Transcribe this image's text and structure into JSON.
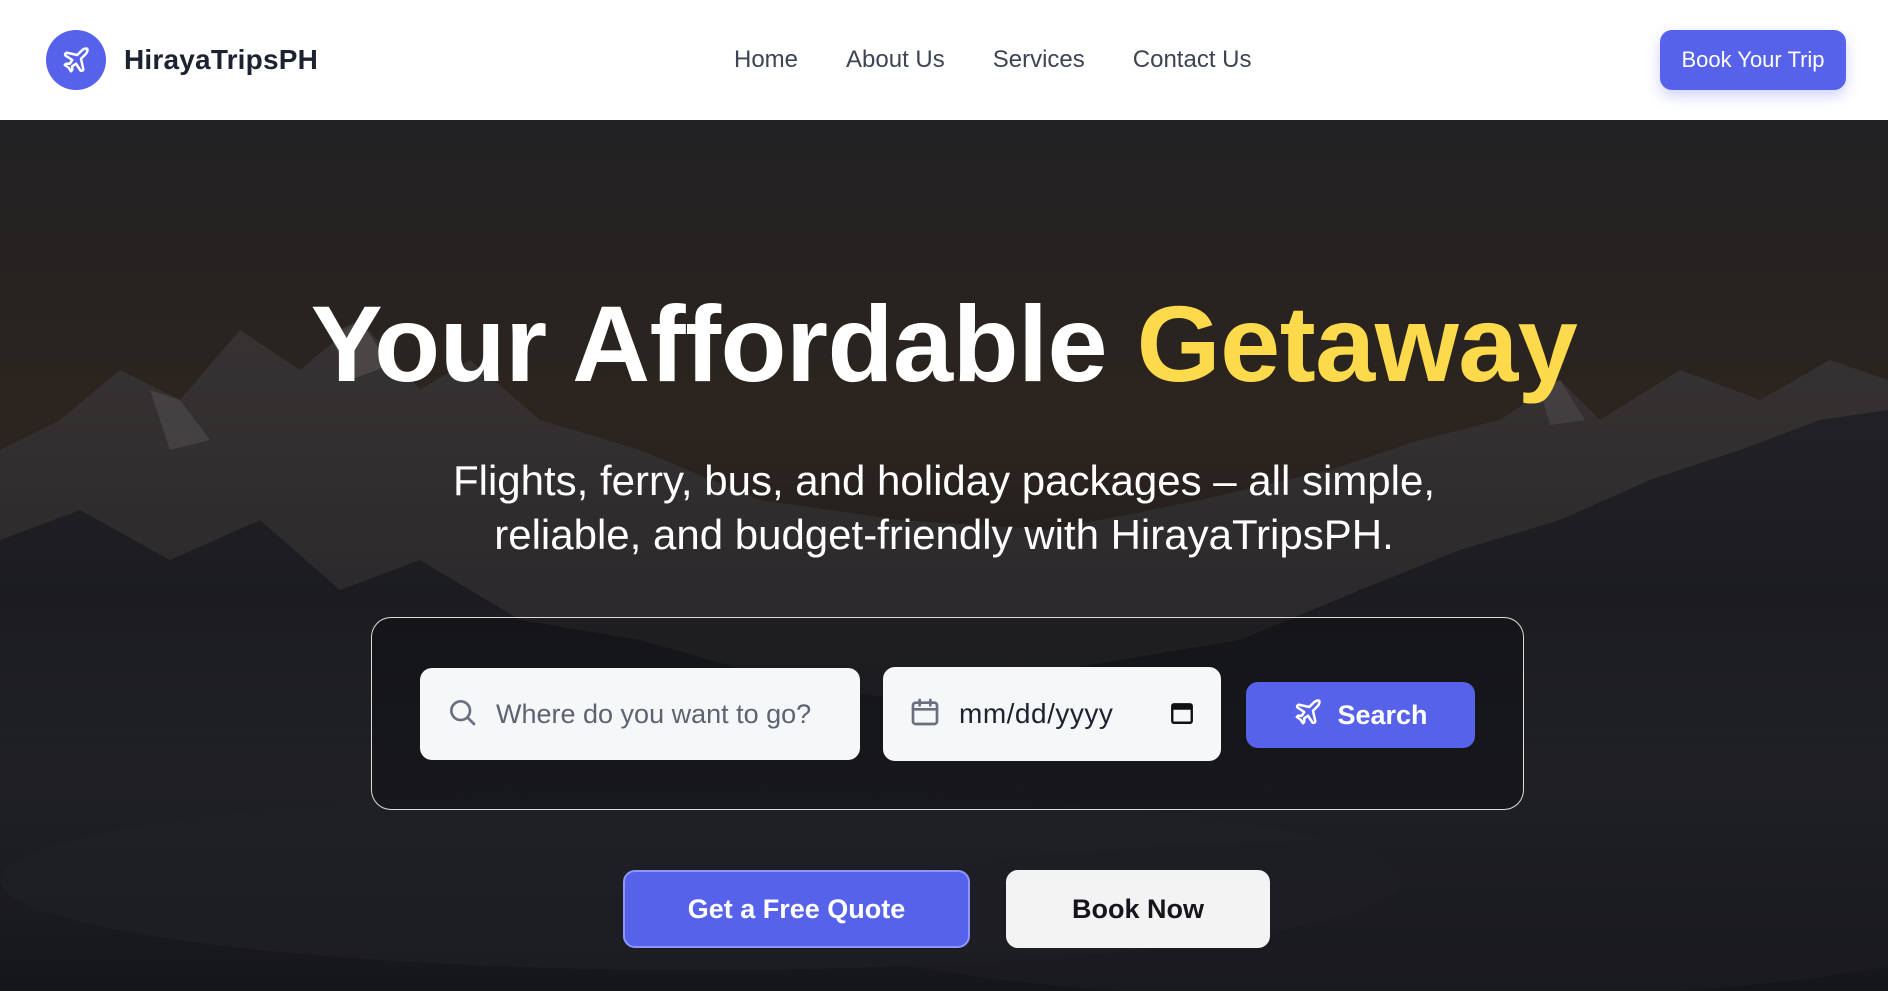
{
  "brand": {
    "name": "HirayaTripsPH",
    "logo_icon": "plane-icon",
    "accent_color": "#5662ea"
  },
  "nav": {
    "links": [
      {
        "label": "Home"
      },
      {
        "label": "About Us"
      },
      {
        "label": "Services"
      },
      {
        "label": "Contact Us"
      }
    ],
    "cta_label": "Book Your Trip"
  },
  "hero": {
    "title_main": "Your Affordable ",
    "title_accent": "Getaway",
    "title_accent_color": "#fdd94c",
    "subtitle": "Flights, ferry, bus, and holiday packages – all simple, reliable, and budget-friendly with HirayaTripsPH.",
    "background": "mountain-landscape-photo"
  },
  "search": {
    "destination_placeholder": "Where do you want to go?",
    "destination_icon": "search-icon",
    "date_placeholder": "mm/dd/yyyy",
    "date_icon": "calendar-icon",
    "search_button_label": "Search",
    "search_button_icon": "plane-icon"
  },
  "cta": {
    "primary_label": "Get a Free Quote",
    "secondary_label": "Book Now"
  }
}
